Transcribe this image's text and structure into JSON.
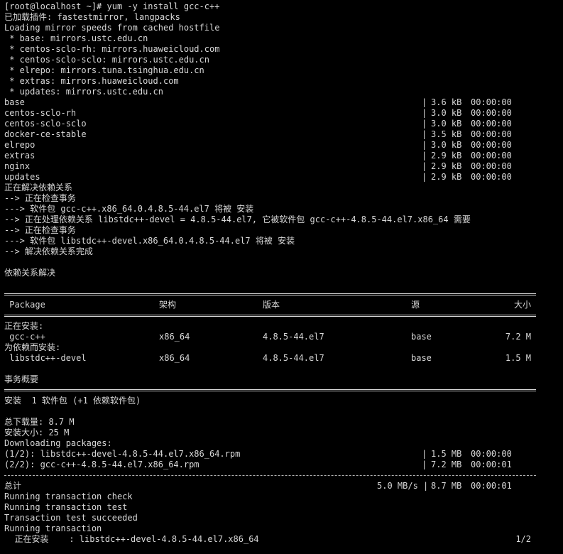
{
  "terminal": {
    "lines": [
      {
        "kind": "text",
        "text": "[root@localhost ~]# yum -y install gcc-c++"
      },
      {
        "kind": "text",
        "text": "已加载插件: fastestmirror, langpacks"
      },
      {
        "kind": "text",
        "text": "Loading mirror speeds from cached hostfile"
      },
      {
        "kind": "text",
        "text": " * base: mirrors.ustc.edu.cn"
      },
      {
        "kind": "text",
        "text": " * centos-sclo-rh: mirrors.huaweicloud.com"
      },
      {
        "kind": "text",
        "text": " * centos-sclo-sclo: mirrors.ustc.edu.cn"
      },
      {
        "kind": "text",
        "text": " * elrepo: mirrors.tuna.tsinghua.edu.cn"
      },
      {
        "kind": "text",
        "text": " * extras: mirrors.huaweicloud.com"
      },
      {
        "kind": "text",
        "text": " * updates: mirrors.ustc.edu.cn"
      },
      {
        "kind": "repo",
        "name": "base",
        "bar": "|",
        "size": "3.6 kB",
        "time": "00:00:00"
      },
      {
        "kind": "repo",
        "name": "centos-sclo-rh",
        "bar": "|",
        "size": "3.0 kB",
        "time": "00:00:00"
      },
      {
        "kind": "repo",
        "name": "centos-sclo-sclo",
        "bar": "|",
        "size": "3.0 kB",
        "time": "00:00:00"
      },
      {
        "kind": "repo",
        "name": "docker-ce-stable",
        "bar": "|",
        "size": "3.5 kB",
        "time": "00:00:00"
      },
      {
        "kind": "repo",
        "name": "elrepo",
        "bar": "|",
        "size": "3.0 kB",
        "time": "00:00:00"
      },
      {
        "kind": "repo",
        "name": "extras",
        "bar": "|",
        "size": "2.9 kB",
        "time": "00:00:00"
      },
      {
        "kind": "repo",
        "name": "nginx",
        "bar": "|",
        "size": "2.9 kB",
        "time": "00:00:00"
      },
      {
        "kind": "repo",
        "name": "updates",
        "bar": "|",
        "size": "2.9 kB",
        "time": "00:00:00"
      },
      {
        "kind": "text",
        "text": "正在解决依赖关系"
      },
      {
        "kind": "text",
        "text": "--> 正在检查事务"
      },
      {
        "kind": "text",
        "text": "---> 软件包 gcc-c++.x86_64.0.4.8.5-44.el7 将被 安装"
      },
      {
        "kind": "text",
        "text": "--> 正在处理依赖关系 libstdc++-devel = 4.8.5-44.el7, 它被软件包 gcc-c++-4.8.5-44.el7.x86_64 需要"
      },
      {
        "kind": "text",
        "text": "--> 正在检查事务"
      },
      {
        "kind": "text",
        "text": "---> 软件包 libstdc++-devel.x86_64.0.4.8.5-44.el7 将被 安装"
      },
      {
        "kind": "text",
        "text": "--> 解决依赖关系完成"
      },
      {
        "kind": "text",
        "text": ""
      },
      {
        "kind": "text",
        "text": "依赖关系解决"
      },
      {
        "kind": "text",
        "text": ""
      },
      {
        "kind": "double-rule"
      },
      {
        "kind": "table",
        "c1": " Package",
        "c2": "架构",
        "c3": "版本",
        "c4": "源",
        "c5": "大小"
      },
      {
        "kind": "double-rule"
      },
      {
        "kind": "text",
        "text": "正在安装:"
      },
      {
        "kind": "table",
        "c1": " gcc-c++",
        "c2": "x86_64",
        "c3": "4.8.5-44.el7",
        "c4": "base",
        "c5": "7.2 M"
      },
      {
        "kind": "text",
        "text": "为依赖而安装:"
      },
      {
        "kind": "table",
        "c1": " libstdc++-devel",
        "c2": "x86_64",
        "c3": "4.8.5-44.el7",
        "c4": "base",
        "c5": "1.5 M"
      },
      {
        "kind": "text",
        "text": ""
      },
      {
        "kind": "text",
        "text": "事务概要"
      },
      {
        "kind": "double-rule"
      },
      {
        "kind": "text",
        "text": "安装  1 软件包 (+1 依赖软件包)"
      },
      {
        "kind": "text",
        "text": ""
      },
      {
        "kind": "text",
        "text": "总下载量: 8.7 M"
      },
      {
        "kind": "text",
        "text": "安装大小: 25 M"
      },
      {
        "kind": "text",
        "text": "Downloading packages:"
      },
      {
        "kind": "repo",
        "name": "(1/2): libstdc++-devel-4.8.5-44.el7.x86_64.rpm",
        "bar": "|",
        "size": "1.5 MB",
        "time": "00:00:00"
      },
      {
        "kind": "repo",
        "name": "(2/2): gcc-c++-4.8.5-44.el7.x86_64.rpm",
        "bar": "|",
        "size": "7.2 MB",
        "time": "00:00:01"
      },
      {
        "kind": "dashed-rule"
      },
      {
        "kind": "total",
        "name": "总计",
        "rate": "5.0 MB/s |",
        "size": "8.7 MB",
        "time": "00:00:01"
      },
      {
        "kind": "text",
        "text": "Running transaction check"
      },
      {
        "kind": "text",
        "text": "Running transaction test"
      },
      {
        "kind": "text",
        "text": "Transaction test succeeded"
      },
      {
        "kind": "text",
        "text": "Running transaction"
      },
      {
        "kind": "progress",
        "text": "  正在安装    : libstdc++-devel-4.8.5-44.el7.x86_64",
        "count": "1/2"
      }
    ]
  },
  "colors": {
    "background": "#000000",
    "foreground": "#d8d8d8"
  }
}
